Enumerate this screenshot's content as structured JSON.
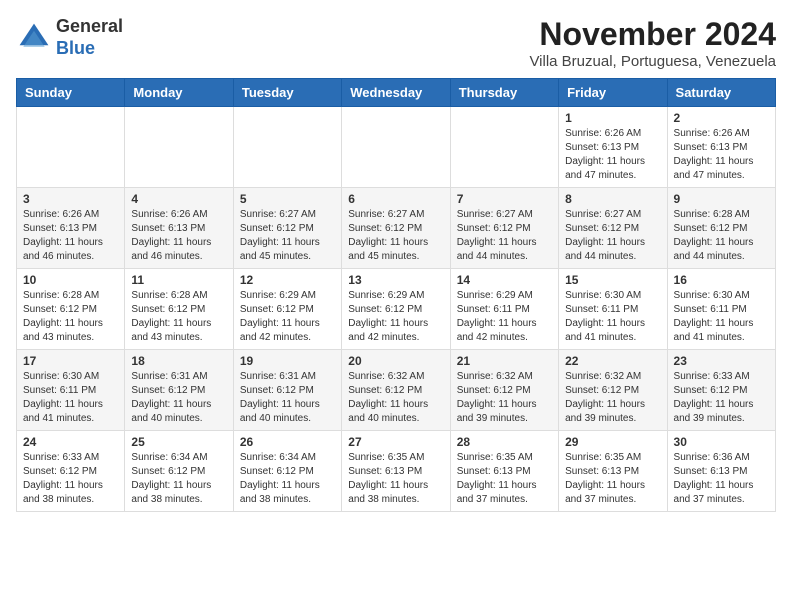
{
  "header": {
    "logo_general": "General",
    "logo_blue": "Blue",
    "month": "November 2024",
    "location": "Villa Bruzual, Portuguesa, Venezuela"
  },
  "weekdays": [
    "Sunday",
    "Monday",
    "Tuesday",
    "Wednesday",
    "Thursday",
    "Friday",
    "Saturday"
  ],
  "weeks": [
    [
      {
        "day": "",
        "info": ""
      },
      {
        "day": "",
        "info": ""
      },
      {
        "day": "",
        "info": ""
      },
      {
        "day": "",
        "info": ""
      },
      {
        "day": "",
        "info": ""
      },
      {
        "day": "1",
        "info": "Sunrise: 6:26 AM\nSunset: 6:13 PM\nDaylight: 11 hours\nand 47 minutes."
      },
      {
        "day": "2",
        "info": "Sunrise: 6:26 AM\nSunset: 6:13 PM\nDaylight: 11 hours\nand 47 minutes."
      }
    ],
    [
      {
        "day": "3",
        "info": "Sunrise: 6:26 AM\nSunset: 6:13 PM\nDaylight: 11 hours\nand 46 minutes."
      },
      {
        "day": "4",
        "info": "Sunrise: 6:26 AM\nSunset: 6:13 PM\nDaylight: 11 hours\nand 46 minutes."
      },
      {
        "day": "5",
        "info": "Sunrise: 6:27 AM\nSunset: 6:12 PM\nDaylight: 11 hours\nand 45 minutes."
      },
      {
        "day": "6",
        "info": "Sunrise: 6:27 AM\nSunset: 6:12 PM\nDaylight: 11 hours\nand 45 minutes."
      },
      {
        "day": "7",
        "info": "Sunrise: 6:27 AM\nSunset: 6:12 PM\nDaylight: 11 hours\nand 44 minutes."
      },
      {
        "day": "8",
        "info": "Sunrise: 6:27 AM\nSunset: 6:12 PM\nDaylight: 11 hours\nand 44 minutes."
      },
      {
        "day": "9",
        "info": "Sunrise: 6:28 AM\nSunset: 6:12 PM\nDaylight: 11 hours\nand 44 minutes."
      }
    ],
    [
      {
        "day": "10",
        "info": "Sunrise: 6:28 AM\nSunset: 6:12 PM\nDaylight: 11 hours\nand 43 minutes."
      },
      {
        "day": "11",
        "info": "Sunrise: 6:28 AM\nSunset: 6:12 PM\nDaylight: 11 hours\nand 43 minutes."
      },
      {
        "day": "12",
        "info": "Sunrise: 6:29 AM\nSunset: 6:12 PM\nDaylight: 11 hours\nand 42 minutes."
      },
      {
        "day": "13",
        "info": "Sunrise: 6:29 AM\nSunset: 6:12 PM\nDaylight: 11 hours\nand 42 minutes."
      },
      {
        "day": "14",
        "info": "Sunrise: 6:29 AM\nSunset: 6:11 PM\nDaylight: 11 hours\nand 42 minutes."
      },
      {
        "day": "15",
        "info": "Sunrise: 6:30 AM\nSunset: 6:11 PM\nDaylight: 11 hours\nand 41 minutes."
      },
      {
        "day": "16",
        "info": "Sunrise: 6:30 AM\nSunset: 6:11 PM\nDaylight: 11 hours\nand 41 minutes."
      }
    ],
    [
      {
        "day": "17",
        "info": "Sunrise: 6:30 AM\nSunset: 6:11 PM\nDaylight: 11 hours\nand 41 minutes."
      },
      {
        "day": "18",
        "info": "Sunrise: 6:31 AM\nSunset: 6:12 PM\nDaylight: 11 hours\nand 40 minutes."
      },
      {
        "day": "19",
        "info": "Sunrise: 6:31 AM\nSunset: 6:12 PM\nDaylight: 11 hours\nand 40 minutes."
      },
      {
        "day": "20",
        "info": "Sunrise: 6:32 AM\nSunset: 6:12 PM\nDaylight: 11 hours\nand 40 minutes."
      },
      {
        "day": "21",
        "info": "Sunrise: 6:32 AM\nSunset: 6:12 PM\nDaylight: 11 hours\nand 39 minutes."
      },
      {
        "day": "22",
        "info": "Sunrise: 6:32 AM\nSunset: 6:12 PM\nDaylight: 11 hours\nand 39 minutes."
      },
      {
        "day": "23",
        "info": "Sunrise: 6:33 AM\nSunset: 6:12 PM\nDaylight: 11 hours\nand 39 minutes."
      }
    ],
    [
      {
        "day": "24",
        "info": "Sunrise: 6:33 AM\nSunset: 6:12 PM\nDaylight: 11 hours\nand 38 minutes."
      },
      {
        "day": "25",
        "info": "Sunrise: 6:34 AM\nSunset: 6:12 PM\nDaylight: 11 hours\nand 38 minutes."
      },
      {
        "day": "26",
        "info": "Sunrise: 6:34 AM\nSunset: 6:12 PM\nDaylight: 11 hours\nand 38 minutes."
      },
      {
        "day": "27",
        "info": "Sunrise: 6:35 AM\nSunset: 6:13 PM\nDaylight: 11 hours\nand 38 minutes."
      },
      {
        "day": "28",
        "info": "Sunrise: 6:35 AM\nSunset: 6:13 PM\nDaylight: 11 hours\nand 37 minutes."
      },
      {
        "day": "29",
        "info": "Sunrise: 6:35 AM\nSunset: 6:13 PM\nDaylight: 11 hours\nand 37 minutes."
      },
      {
        "day": "30",
        "info": "Sunrise: 6:36 AM\nSunset: 6:13 PM\nDaylight: 11 hours\nand 37 minutes."
      }
    ]
  ]
}
